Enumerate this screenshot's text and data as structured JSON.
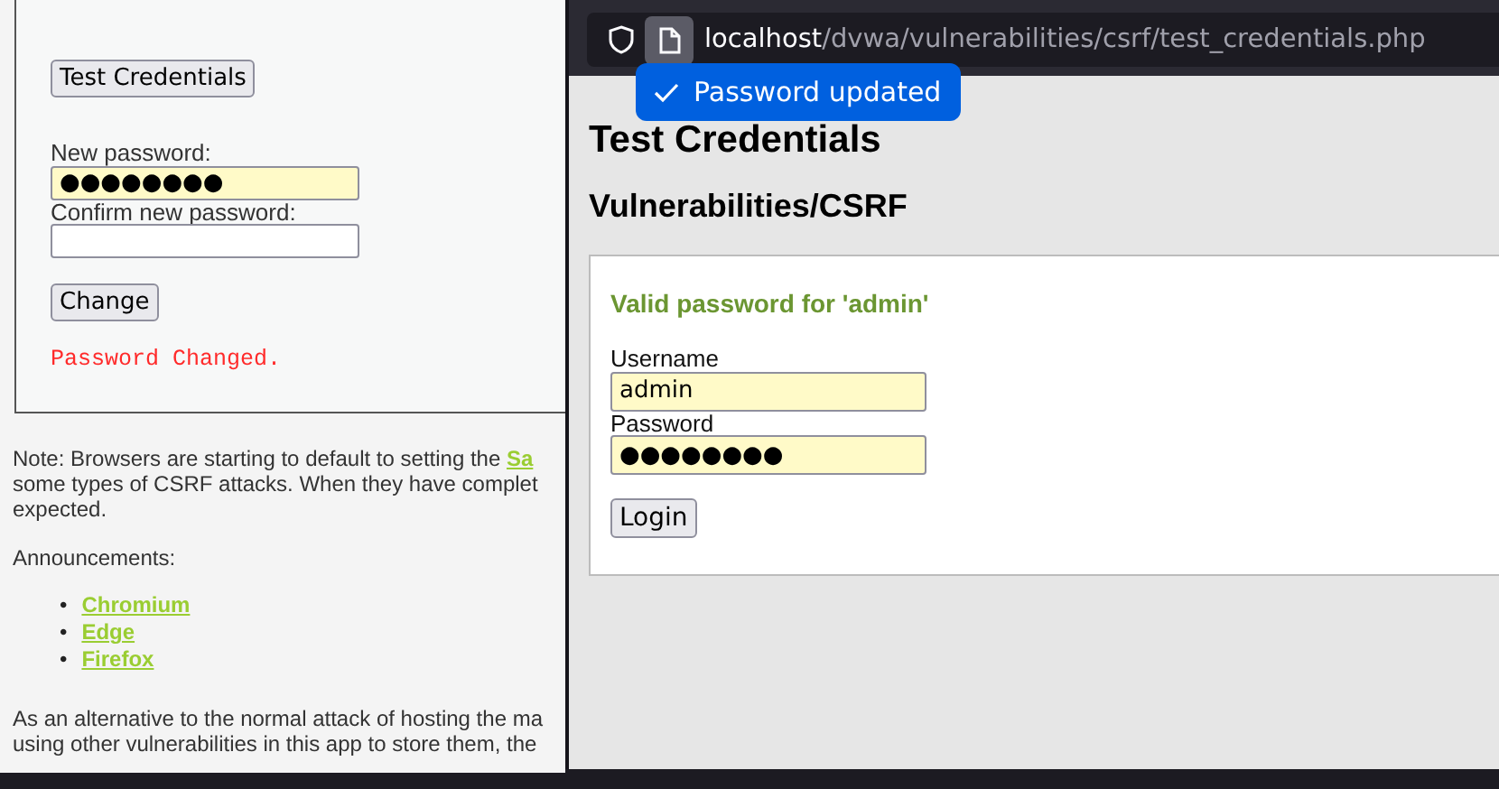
{
  "background_page": {
    "test_button": "Test Credentials",
    "fields": [
      {
        "label": "New password:",
        "value": "●●●●●●●●",
        "autofilled": true
      },
      {
        "label": "Confirm new password:",
        "autofilled": false
      }
    ],
    "change_button": "Change",
    "message": "Password Changed.",
    "note": {
      "lines": [
        "Note: Browsers are starting to default to setting the ",
        "some types of CSRF attacks. When they have complet",
        "expected."
      ],
      "link": "Sa"
    },
    "announcements_label": "Announcements:",
    "links": [
      {
        "marker": "•",
        "label": "Chromium"
      },
      {
        "marker": "•",
        "label": "Edge"
      },
      {
        "marker": "•",
        "label": "Firefox"
      }
    ],
    "closing": {
      "lines": [
        "As an alternative to the normal attack of hosting the ma",
        "using other vulnerabilities in this app to store them, the"
      ]
    }
  },
  "popup_window": {
    "url": {
      "host": "localhost",
      "path": "/dvwa/vulnerabilities/csrf/test_credentials.php"
    },
    "toast": "Password updated",
    "title": "Test Credentials",
    "subtitle": "Vulnerabilities/CSRF",
    "result": "Valid password for 'admin'",
    "fields": [
      {
        "label": "Username",
        "value": "admin",
        "autofilled": true
      },
      {
        "label": "Password",
        "value": "●●●●●●●●",
        "autofilled": true
      }
    ],
    "button": "Login"
  }
}
